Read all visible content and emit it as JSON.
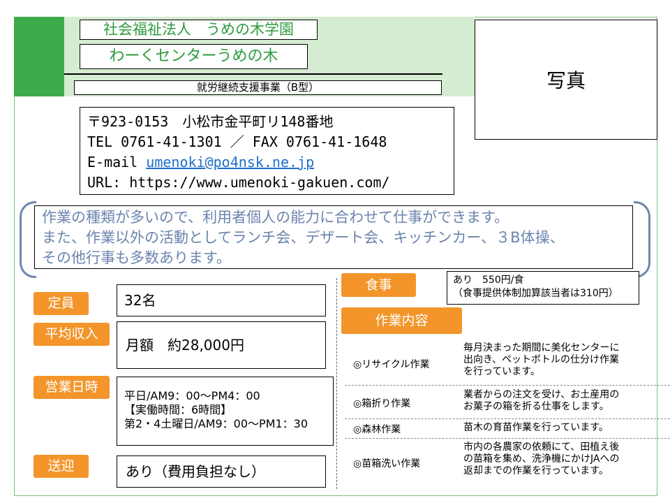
{
  "header": {
    "corporation": "社会福祉法人　うめの木学園",
    "center_name": "わーくセンターうめの木",
    "business_type": "就労継続支援事業（B型）",
    "photo_label": "写真"
  },
  "contact": {
    "address": "〒923-0153　小松市金平町リ148番地",
    "tel_fax": "TEL 0761-41-1301 ／ FAX 0761-41-1648",
    "email_prefix": "E-mail ",
    "email": "umenoki@po4nsk.ne.jp",
    "url": "URL: https://www.umenoki-gakuen.com/"
  },
  "description": {
    "line1": "作業の種類が多いので、利用者個人の能力に合わせて仕事ができます。",
    "line2": "また、作業以外の活動としてランチ会、デザート会、キッチンカー、３B体操、",
    "line3": "その他行事も多数あります。"
  },
  "details": {
    "capacity": {
      "label": "定員",
      "value": "32名"
    },
    "income": {
      "label": "平均収入",
      "value": "月額　約28,000円"
    },
    "hours": {
      "label": "営業日時",
      "line1": "平日/AM9：00～PM4：00",
      "line2": "【実働時間：6時間】",
      "line3": "第2・4土曜日/AM9：00～PM1：30"
    },
    "transport": {
      "label": "送迎",
      "value": "あり（費用負担なし）"
    }
  },
  "meal": {
    "label": "食事",
    "line1": "あり　550円/食",
    "line2": "（食事提供体制加算該当者は310円）"
  },
  "work": {
    "label": "作業内容",
    "items": [
      {
        "name": "◎リサイクル作業",
        "desc": [
          "毎月決まった期間に美化センターに",
          "出向き、ペットボトルの仕分け作業",
          "を行っています。"
        ]
      },
      {
        "name": "◎箱折り作業",
        "desc": [
          "業者からの注文を受け、お土産用の",
          "お菓子の箱を折る仕事をします。"
        ]
      },
      {
        "name": "◎森林作業",
        "desc": [
          "苗木の育苗作業を行っています。"
        ]
      },
      {
        "name": "◎苗箱洗い作業",
        "desc": [
          "市内の各農家の依頼にて、田植え後",
          "の苗箱を集め、洗浄機にかけJAへの",
          "返却までの作業を行っています。"
        ]
      }
    ]
  },
  "colors": {
    "green": "#3daa4a",
    "light_green": "#d6ecd2",
    "orange": "#f3952a",
    "text_blue": "#6b84ad",
    "link": "#1e6fc8"
  }
}
